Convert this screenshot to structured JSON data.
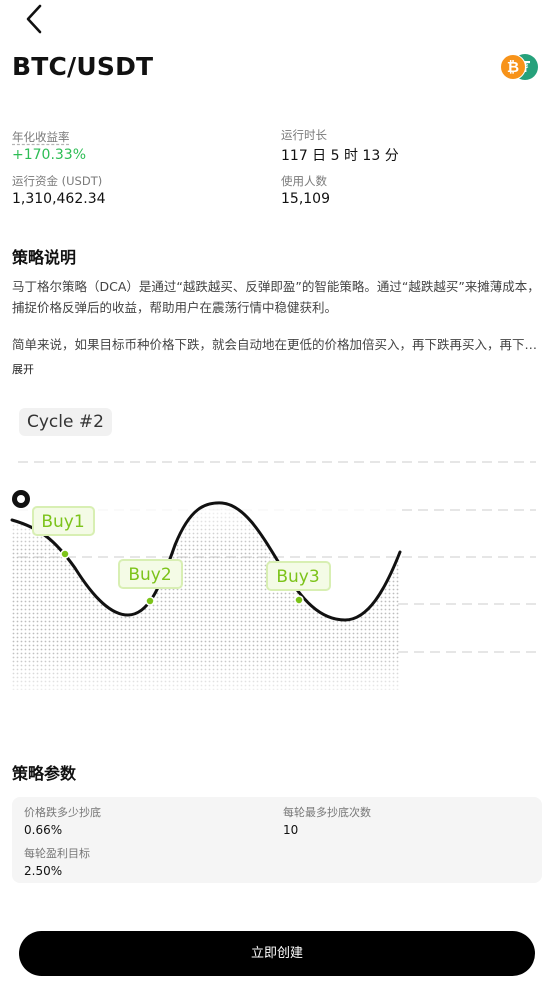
{
  "header": {
    "pair": "BTC/USDT",
    "coin_icons": [
      "bitcoin-icon",
      "tether-icon"
    ],
    "btc_glyph": "₿",
    "usdt_glyph": "₮"
  },
  "stats": {
    "annual_yield_label": "年化收益率",
    "annual_yield_value": "+170.33%",
    "runtime_label": "运行时长",
    "runtime_value": "117 日 5 时 13 分",
    "funds_label": "运行资金 (USDT)",
    "funds_value": "1,310,462.34",
    "users_label": "使用人数",
    "users_value": "15,109"
  },
  "strategy": {
    "title": "策略说明",
    "paragraph1": "马丁格尔策略（DCA）是通过“越跌越买、反弹即盈”的智能策略。通过“越跌越买”来摊薄成本，捕捉价格反弹后的收益，帮助用户在震荡行情中稳健获利。",
    "paragraph2": "简单来说，如果目标币种价格下跌，就会自动地在更低的价格加倍买入，再下跌再买入，再下跌再买入，直到价格反弹获利卖出。",
    "expand": "展开"
  },
  "illustration": {
    "cycle": "Cycle #2",
    "buys": [
      "Buy1",
      "Buy2",
      "Buy3"
    ],
    "accent_color": "#7cc31a"
  },
  "params": {
    "title": "策略参数",
    "drop_label": "价格跌多少抄底",
    "drop_value": "0.66%",
    "max_buys_label": "每轮最多抄底次数",
    "max_buys_value": "10",
    "profit_label": "每轮盈利目标",
    "profit_value": "2.50%"
  },
  "cta": {
    "label": "立即创建"
  },
  "colors": {
    "positive": "#2ebd55",
    "primary_button": "#000000",
    "btc": "#f7931a",
    "usdt": "#26a17b"
  }
}
